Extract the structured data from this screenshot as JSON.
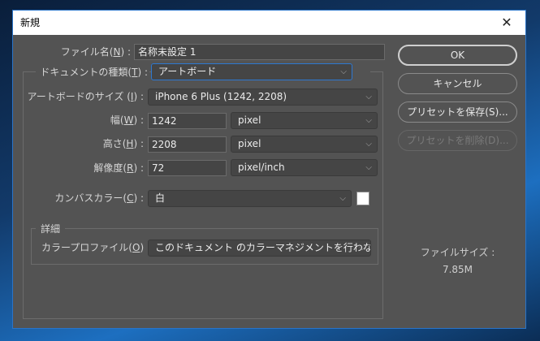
{
  "window": {
    "title": "新規",
    "close_icon": "close-icon"
  },
  "fields": {
    "filename": {
      "label_pre": "ファイル名(",
      "key": "N",
      "label_post": ") :",
      "value": "名称未設定 1"
    },
    "doc_type": {
      "label_pre": "ドキュメントの種類(",
      "key": "T",
      "label_post": ") :",
      "value": "アートボード"
    },
    "artboard_size": {
      "label_pre": "アートボードのサイズ (",
      "key": "I",
      "label_post": ") :",
      "value": "iPhone 6 Plus (1242, 2208)"
    },
    "width": {
      "label_pre": "幅(",
      "key": "W",
      "label_post": ") :",
      "value": "1242",
      "unit": "pixel"
    },
    "height": {
      "label_pre": "高さ(",
      "key": "H",
      "label_post": ") :",
      "value": "2208",
      "unit": "pixel"
    },
    "resolution": {
      "label_pre": "解像度(",
      "key": "R",
      "label_post": ") :",
      "value": "72",
      "unit": "pixel/inch"
    },
    "canvas_color": {
      "label_pre": "カンバスカラー(",
      "key": "C",
      "label_post": ") :",
      "value": "白",
      "swatch": "#ffffff"
    },
    "advanced": {
      "legend": "詳細"
    },
    "color_profile": {
      "label_pre": "カラープロファイル(",
      "key": "O",
      "label_post": ") :",
      "value": "このドキュメント のカラーマネジメントを行わない"
    }
  },
  "buttons": {
    "ok": "OK",
    "cancel": "キャンセル",
    "save_preset": "プリセットを保存(S)...",
    "delete_preset": "プリセットを削除(D)..."
  },
  "file_size": {
    "label": "ファイルサイズ :",
    "value": "7.85M"
  },
  "colors": {
    "dialog_bg": "#535353",
    "focus": "#2d78d0"
  }
}
